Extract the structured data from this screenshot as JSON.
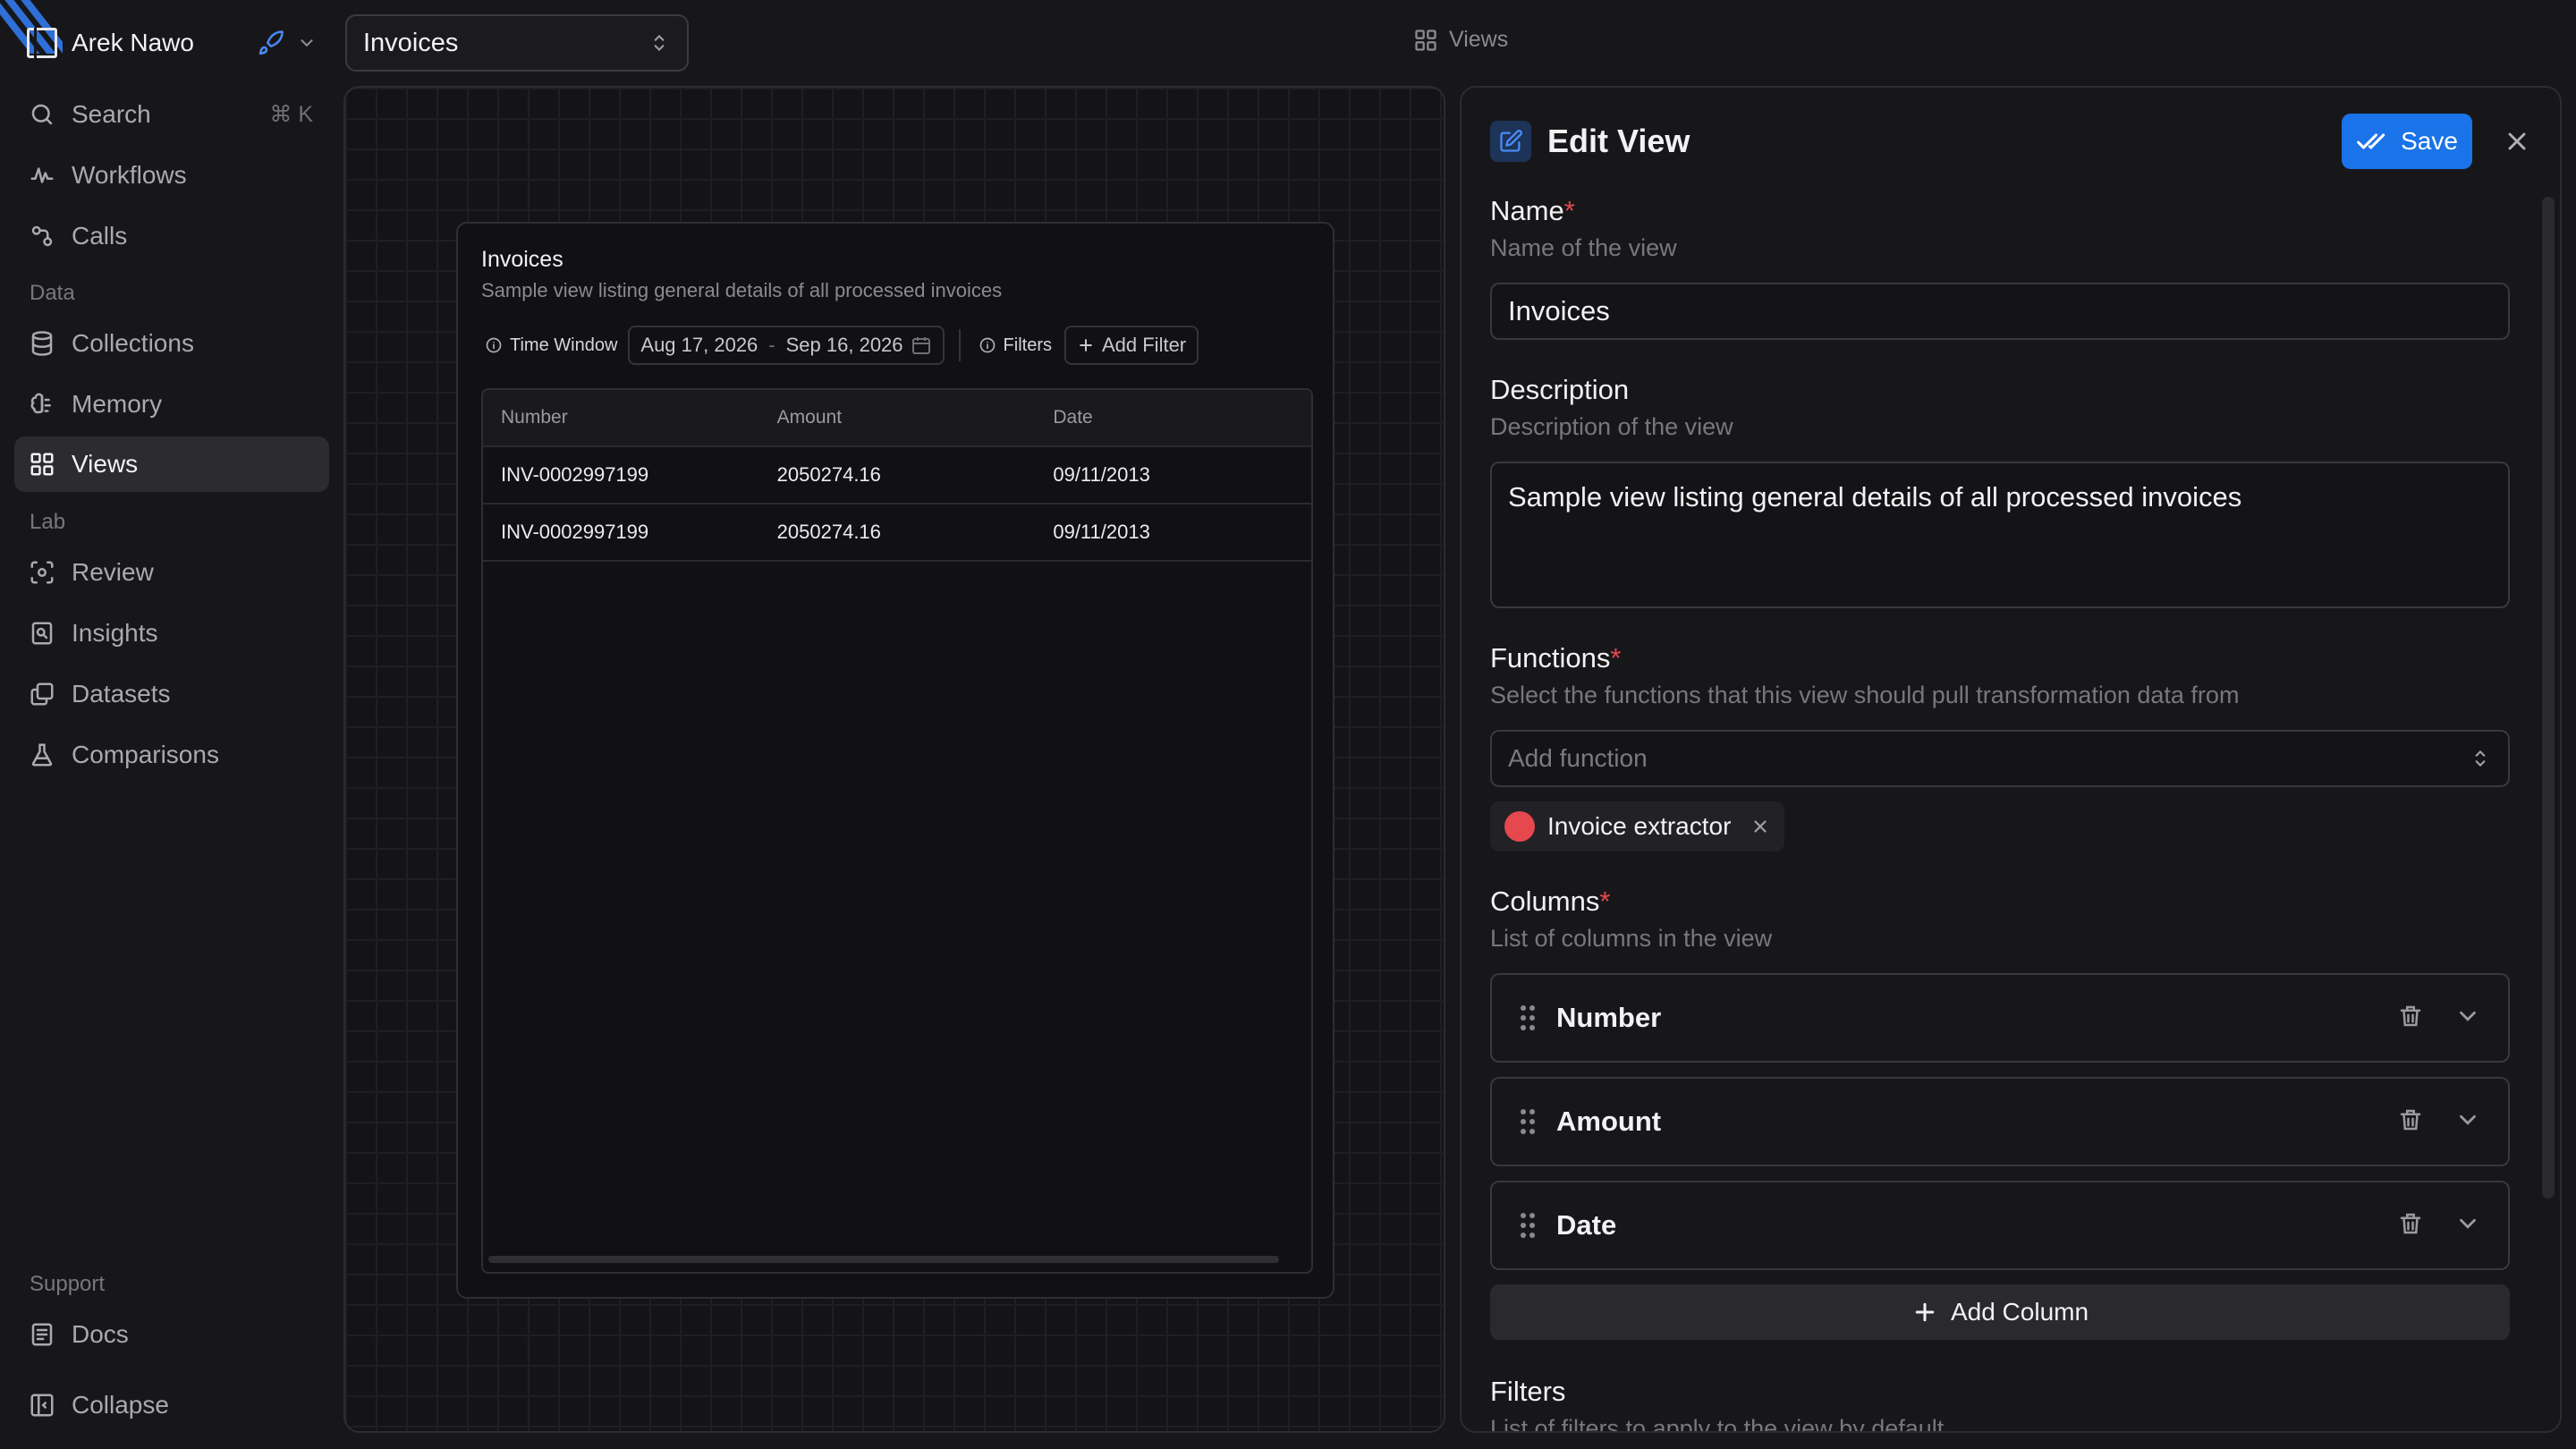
{
  "workspace": {
    "name": "Arek Nawo"
  },
  "sidebar": {
    "search": {
      "label": "Search",
      "shortcut": "⌘ K"
    },
    "items_top": [
      {
        "label": "Workflows",
        "icon": "workflow-icon"
      },
      {
        "label": "Calls",
        "icon": "calls-icon"
      }
    ],
    "data_label": "Data",
    "items_data": [
      {
        "label": "Collections",
        "icon": "database-icon"
      },
      {
        "label": "Memory",
        "icon": "brain-icon"
      },
      {
        "label": "Views",
        "icon": "grid-icon",
        "active": true
      }
    ],
    "lab_label": "Lab",
    "items_lab": [
      {
        "label": "Review",
        "icon": "review-icon"
      },
      {
        "label": "Insights",
        "icon": "insights-icon"
      },
      {
        "label": "Datasets",
        "icon": "datasets-icon"
      },
      {
        "label": "Comparisons",
        "icon": "flask-icon"
      }
    ],
    "support_label": "Support",
    "docs": {
      "label": "Docs"
    },
    "collapse": {
      "label": "Collapse"
    }
  },
  "topbar": {
    "view_select": "Invoices",
    "breadcrumb": "Views"
  },
  "preview": {
    "title": "Invoices",
    "description": "Sample view listing general details of all processed invoices",
    "time_window_label": "Time Window",
    "date_from": "Aug 17, 2026",
    "date_to": "Sep 16, 2026",
    "filters_label": "Filters",
    "add_filter": "Add Filter",
    "columns": [
      "Number",
      "Amount",
      "Date"
    ],
    "rows": [
      [
        "INV-0002997199",
        "2050274.16",
        "09/11/2013"
      ],
      [
        "INV-0002997199",
        "2050274.16",
        "09/11/2013"
      ]
    ]
  },
  "panel": {
    "title": "Edit View",
    "save": "Save",
    "name": {
      "label": "Name",
      "required": "*",
      "help": "Name of the view",
      "value": "Invoices"
    },
    "description": {
      "label": "Description",
      "help": "Description of the view",
      "value": "Sample view listing general details of all processed invoices"
    },
    "functions": {
      "label": "Functions",
      "required": "*",
      "help": "Select the functions that this view should pull transformation data from",
      "placeholder": "Add function",
      "selected": "Invoice extractor",
      "tag_color": "#e5484d"
    },
    "columns": {
      "label": "Columns",
      "required": "*",
      "help": "List of columns in the view",
      "items": [
        "Number",
        "Amount",
        "Date"
      ],
      "add": "Add Column"
    },
    "filters": {
      "label": "Filters",
      "help": "List of filters to apply to the view by default"
    }
  },
  "colors": {
    "accent": "#1a73e8",
    "required": "#e5484d",
    "background": "#17171a"
  }
}
